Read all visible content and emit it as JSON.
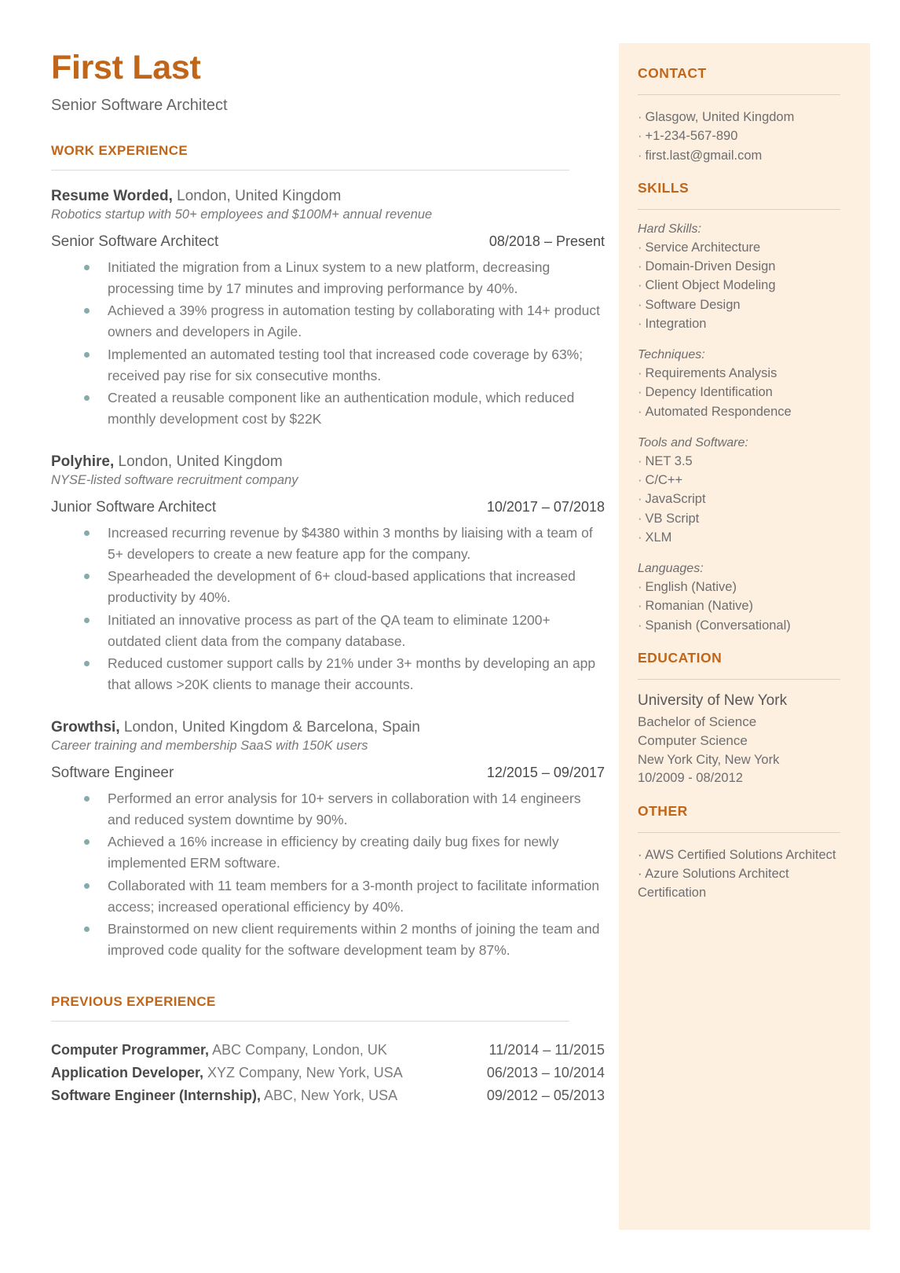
{
  "header": {
    "name": "First Last",
    "title": "Senior Software Architect"
  },
  "sections": {
    "work_experience": "WORK EXPERIENCE",
    "previous_experience": "PREVIOUS EXPERIENCE",
    "contact": "CONTACT",
    "skills": "SKILLS",
    "education": "EDUCATION",
    "other": "OTHER"
  },
  "jobs": [
    {
      "company": "Resume Worded,",
      "location": " London, United Kingdom",
      "tagline": "Robotics startup with 50+ employees and $100M+ annual revenue",
      "role": "Senior Software Architect",
      "dates": "08/2018 – Present",
      "bullets": [
        "Initiated the migration from a Linux system to a new platform, decreasing processing time by 17 minutes and improving performance by 40%.",
        "Achieved a 39% progress in automation testing by collaborating with 14+ product owners and developers in Agile.",
        "Implemented an automated testing tool that increased code coverage by 63%; received pay rise for six consecutive months.",
        "Created a reusable component like an authentication module, which reduced monthly development cost by $22K"
      ]
    },
    {
      "company": "Polyhire,",
      "location": " London, United Kingdom",
      "tagline": "NYSE-listed software recruitment company",
      "role": "Junior Software Architect",
      "dates": "10/2017 – 07/2018",
      "bullets": [
        "Increased recurring revenue by $4380 within 3 months by liaising with a team of 5+ developers to create a new feature app for the company.",
        "Spearheaded the development of 6+ cloud-based applications that increased productivity by 40%.",
        "Initiated an innovative process as part of the QA team to eliminate 1200+ outdated client data from the company database.",
        "Reduced customer support calls by 21% under 3+ months by developing an app that allows >20K clients to manage their accounts."
      ]
    },
    {
      "company": "Growthsi,",
      "location": " London, United Kingdom & Barcelona, Spain",
      "tagline": "Career training and membership SaaS with 150K users",
      "role": "Software Engineer",
      "dates": "12/2015 – 09/2017",
      "bullets": [
        "Performed an error analysis for 10+ servers in collaboration with 14 engineers and reduced system downtime by 90%.",
        "Achieved a 16% increase in efficiency by creating daily bug fixes for newly implemented ERM software.",
        "Collaborated with 11 team members for a 3-month project to facilitate information access; increased operational efficiency by 40%.",
        "Brainstormed on new client requirements within 2 months of joining the team and improved code quality for the software development team by 87%."
      ]
    }
  ],
  "previous_experience": [
    {
      "role": "Computer Programmer,",
      "detail": " ABC Company, London, UK",
      "dates": "11/2014 – 11/2015"
    },
    {
      "role": "Application Developer,",
      "detail": " XYZ Company, New York, USA",
      "dates": "06/2013 – 10/2014"
    },
    {
      "role": "Software Engineer (Internship),",
      "detail": " ABC, New York, USA",
      "dates": "09/2012 – 05/2013"
    }
  ],
  "contact": [
    "Glasgow, United Kingdom",
    "+1-234-567-890",
    "first.last@gmail.com"
  ],
  "skills": {
    "groups": [
      {
        "label": "Hard Skills:",
        "items": [
          "Service Architecture",
          "Domain-Driven Design",
          "Client Object Modeling",
          "Software Design",
          "Integration"
        ]
      },
      {
        "label": "Techniques:",
        "items": [
          "Requirements Analysis",
          "Depency Identification",
          "Automated Respondence"
        ]
      },
      {
        "label": "Tools and Software:",
        "items": [
          "NET 3.5",
          "C/C++",
          "JavaScript",
          "VB Script",
          "XLM"
        ]
      },
      {
        "label": "Languages:",
        "items": [
          "English (Native)",
          "Romanian (Native)",
          "Spanish (Conversational)"
        ]
      }
    ]
  },
  "education": {
    "school": "University of New York",
    "degree": "Bachelor of Science",
    "major": "Computer Science",
    "location": "New York City, New York",
    "dates": "10/2009  -  08/2012"
  },
  "other": [
    "AWS Certified Solutions Architect",
    "Azure Solutions Architect Certification"
  ],
  "theme": {
    "accent": "#c0661a",
    "sidebar_bg": "#fdf0e1",
    "bullet": "#85acac",
    "body_text": "#77777a"
  }
}
